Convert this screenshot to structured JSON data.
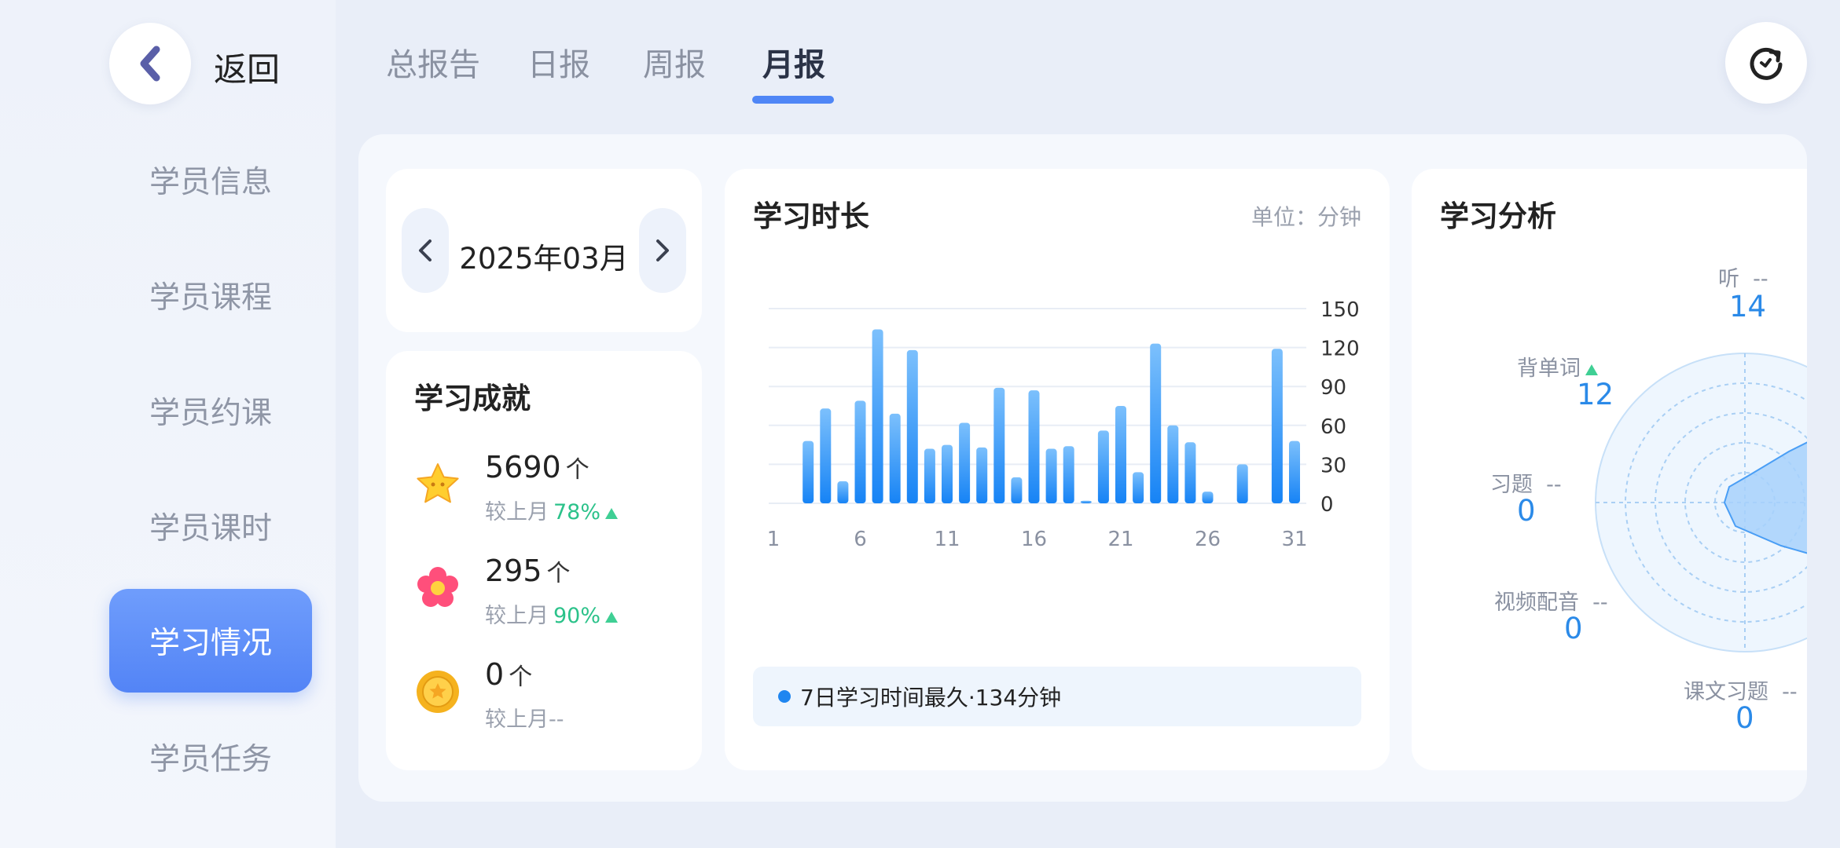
{
  "sidebar": {
    "back_label": "返回",
    "items": [
      {
        "label": "学员信息"
      },
      {
        "label": "学员课程"
      },
      {
        "label": "学员约课"
      },
      {
        "label": "学员课时"
      },
      {
        "label": "学习情况"
      },
      {
        "label": "学员任务"
      }
    ]
  },
  "tabs": [
    {
      "label": "总报告"
    },
    {
      "label": "日报"
    },
    {
      "label": "周报"
    },
    {
      "label": "月报"
    }
  ],
  "month": {
    "label": "2025年03月"
  },
  "achievements": {
    "title": "学习成就",
    "items": [
      {
        "icon": "star-icon",
        "value": "5690",
        "unit": "个",
        "compare_label": "较上月",
        "percent": "78%"
      },
      {
        "icon": "flower-icon",
        "value": "295",
        "unit": "个",
        "compare_label": "较上月",
        "percent": "90%"
      },
      {
        "icon": "coin-icon",
        "value": "0",
        "unit": "个",
        "compare_label": "较上月--",
        "percent": ""
      }
    ]
  },
  "study_time": {
    "title": "学习时长",
    "unit_label": "单位：分钟",
    "summary": "7日学习时间最久·134分钟"
  },
  "chart_data": {
    "type": "bar",
    "x": [
      1,
      2,
      3,
      4,
      5,
      6,
      7,
      8,
      9,
      10,
      11,
      12,
      13,
      14,
      15,
      16,
      17,
      18,
      19,
      20,
      21,
      22,
      23,
      24,
      25,
      26,
      27,
      28,
      29,
      30,
      31
    ],
    "values": [
      0,
      0,
      48,
      73,
      17,
      79,
      134,
      69,
      118,
      42,
      45,
      62,
      43,
      89,
      20,
      87,
      42,
      44,
      2,
      56,
      75,
      24,
      123,
      60,
      47,
      9,
      0,
      30,
      0,
      119,
      48
    ],
    "x_tick_labels": [
      "1",
      "6",
      "11",
      "16",
      "21",
      "26",
      "31"
    ],
    "y_ticks": [
      0,
      30,
      60,
      90,
      120,
      150
    ],
    "ylim": [
      0,
      150
    ],
    "colors": {
      "top": "#7cc0fc",
      "bottom": "#1683f5",
      "grid": "#e8edf5"
    }
  },
  "analysis": {
    "title": "学习分析",
    "items": [
      {
        "name": "听",
        "value": "14",
        "trend": "--"
      },
      {
        "name": "背单词",
        "value": "12",
        "trend": "up"
      },
      {
        "name": "习题",
        "value": "0",
        "trend": "--"
      },
      {
        "name": "视频配音",
        "value": "0",
        "trend": "--"
      },
      {
        "name": "课文习题",
        "value": "0",
        "trend": "--"
      }
    ],
    "dash_text": "--"
  }
}
